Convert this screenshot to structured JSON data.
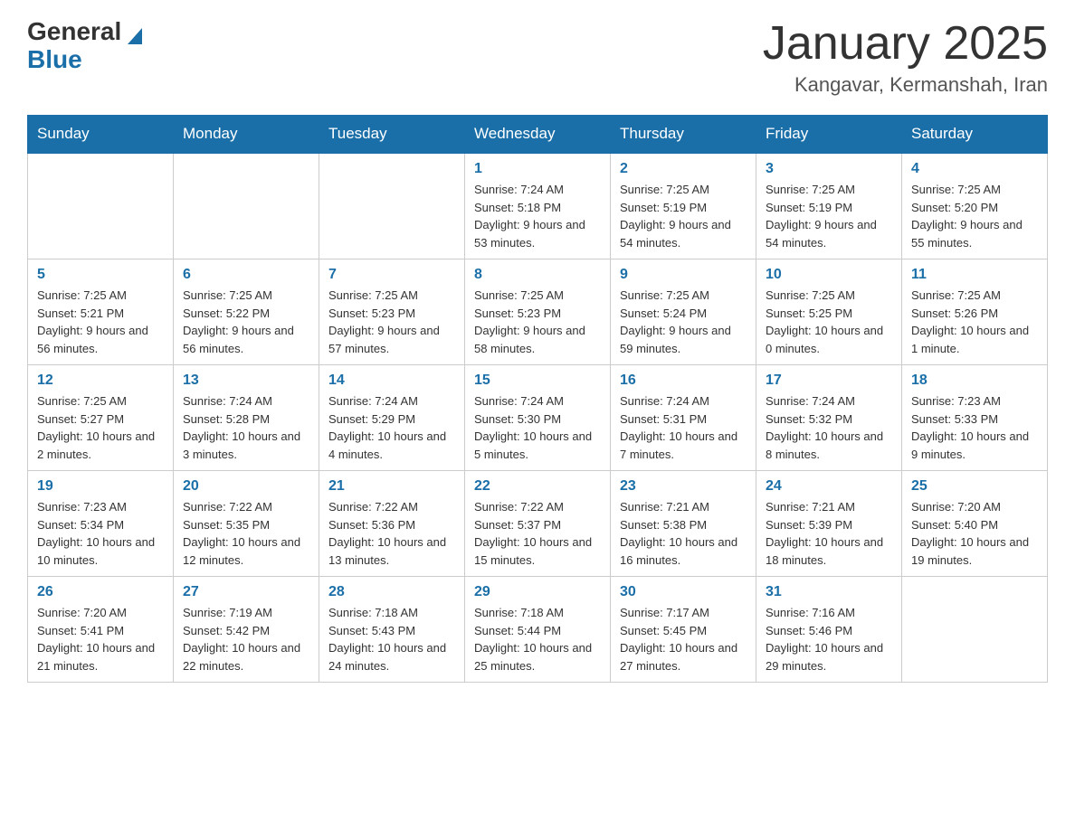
{
  "header": {
    "logo_general": "General",
    "logo_blue": "Blue",
    "month_title": "January 2025",
    "location": "Kangavar, Kermanshah, Iran"
  },
  "days_of_week": [
    "Sunday",
    "Monday",
    "Tuesday",
    "Wednesday",
    "Thursday",
    "Friday",
    "Saturday"
  ],
  "weeks": [
    [
      {
        "day": "",
        "sunrise": "",
        "sunset": "",
        "daylight": ""
      },
      {
        "day": "",
        "sunrise": "",
        "sunset": "",
        "daylight": ""
      },
      {
        "day": "",
        "sunrise": "",
        "sunset": "",
        "daylight": ""
      },
      {
        "day": "1",
        "sunrise": "Sunrise: 7:24 AM",
        "sunset": "Sunset: 5:18 PM",
        "daylight": "Daylight: 9 hours and 53 minutes."
      },
      {
        "day": "2",
        "sunrise": "Sunrise: 7:25 AM",
        "sunset": "Sunset: 5:19 PM",
        "daylight": "Daylight: 9 hours and 54 minutes."
      },
      {
        "day": "3",
        "sunrise": "Sunrise: 7:25 AM",
        "sunset": "Sunset: 5:19 PM",
        "daylight": "Daylight: 9 hours and 54 minutes."
      },
      {
        "day": "4",
        "sunrise": "Sunrise: 7:25 AM",
        "sunset": "Sunset: 5:20 PM",
        "daylight": "Daylight: 9 hours and 55 minutes."
      }
    ],
    [
      {
        "day": "5",
        "sunrise": "Sunrise: 7:25 AM",
        "sunset": "Sunset: 5:21 PM",
        "daylight": "Daylight: 9 hours and 56 minutes."
      },
      {
        "day": "6",
        "sunrise": "Sunrise: 7:25 AM",
        "sunset": "Sunset: 5:22 PM",
        "daylight": "Daylight: 9 hours and 56 minutes."
      },
      {
        "day": "7",
        "sunrise": "Sunrise: 7:25 AM",
        "sunset": "Sunset: 5:23 PM",
        "daylight": "Daylight: 9 hours and 57 minutes."
      },
      {
        "day": "8",
        "sunrise": "Sunrise: 7:25 AM",
        "sunset": "Sunset: 5:23 PM",
        "daylight": "Daylight: 9 hours and 58 minutes."
      },
      {
        "day": "9",
        "sunrise": "Sunrise: 7:25 AM",
        "sunset": "Sunset: 5:24 PM",
        "daylight": "Daylight: 9 hours and 59 minutes."
      },
      {
        "day": "10",
        "sunrise": "Sunrise: 7:25 AM",
        "sunset": "Sunset: 5:25 PM",
        "daylight": "Daylight: 10 hours and 0 minutes."
      },
      {
        "day": "11",
        "sunrise": "Sunrise: 7:25 AM",
        "sunset": "Sunset: 5:26 PM",
        "daylight": "Daylight: 10 hours and 1 minute."
      }
    ],
    [
      {
        "day": "12",
        "sunrise": "Sunrise: 7:25 AM",
        "sunset": "Sunset: 5:27 PM",
        "daylight": "Daylight: 10 hours and 2 minutes."
      },
      {
        "day": "13",
        "sunrise": "Sunrise: 7:24 AM",
        "sunset": "Sunset: 5:28 PM",
        "daylight": "Daylight: 10 hours and 3 minutes."
      },
      {
        "day": "14",
        "sunrise": "Sunrise: 7:24 AM",
        "sunset": "Sunset: 5:29 PM",
        "daylight": "Daylight: 10 hours and 4 minutes."
      },
      {
        "day": "15",
        "sunrise": "Sunrise: 7:24 AM",
        "sunset": "Sunset: 5:30 PM",
        "daylight": "Daylight: 10 hours and 5 minutes."
      },
      {
        "day": "16",
        "sunrise": "Sunrise: 7:24 AM",
        "sunset": "Sunset: 5:31 PM",
        "daylight": "Daylight: 10 hours and 7 minutes."
      },
      {
        "day": "17",
        "sunrise": "Sunrise: 7:24 AM",
        "sunset": "Sunset: 5:32 PM",
        "daylight": "Daylight: 10 hours and 8 minutes."
      },
      {
        "day": "18",
        "sunrise": "Sunrise: 7:23 AM",
        "sunset": "Sunset: 5:33 PM",
        "daylight": "Daylight: 10 hours and 9 minutes."
      }
    ],
    [
      {
        "day": "19",
        "sunrise": "Sunrise: 7:23 AM",
        "sunset": "Sunset: 5:34 PM",
        "daylight": "Daylight: 10 hours and 10 minutes."
      },
      {
        "day": "20",
        "sunrise": "Sunrise: 7:22 AM",
        "sunset": "Sunset: 5:35 PM",
        "daylight": "Daylight: 10 hours and 12 minutes."
      },
      {
        "day": "21",
        "sunrise": "Sunrise: 7:22 AM",
        "sunset": "Sunset: 5:36 PM",
        "daylight": "Daylight: 10 hours and 13 minutes."
      },
      {
        "day": "22",
        "sunrise": "Sunrise: 7:22 AM",
        "sunset": "Sunset: 5:37 PM",
        "daylight": "Daylight: 10 hours and 15 minutes."
      },
      {
        "day": "23",
        "sunrise": "Sunrise: 7:21 AM",
        "sunset": "Sunset: 5:38 PM",
        "daylight": "Daylight: 10 hours and 16 minutes."
      },
      {
        "day": "24",
        "sunrise": "Sunrise: 7:21 AM",
        "sunset": "Sunset: 5:39 PM",
        "daylight": "Daylight: 10 hours and 18 minutes."
      },
      {
        "day": "25",
        "sunrise": "Sunrise: 7:20 AM",
        "sunset": "Sunset: 5:40 PM",
        "daylight": "Daylight: 10 hours and 19 minutes."
      }
    ],
    [
      {
        "day": "26",
        "sunrise": "Sunrise: 7:20 AM",
        "sunset": "Sunset: 5:41 PM",
        "daylight": "Daylight: 10 hours and 21 minutes."
      },
      {
        "day": "27",
        "sunrise": "Sunrise: 7:19 AM",
        "sunset": "Sunset: 5:42 PM",
        "daylight": "Daylight: 10 hours and 22 minutes."
      },
      {
        "day": "28",
        "sunrise": "Sunrise: 7:18 AM",
        "sunset": "Sunset: 5:43 PM",
        "daylight": "Daylight: 10 hours and 24 minutes."
      },
      {
        "day": "29",
        "sunrise": "Sunrise: 7:18 AM",
        "sunset": "Sunset: 5:44 PM",
        "daylight": "Daylight: 10 hours and 25 minutes."
      },
      {
        "day": "30",
        "sunrise": "Sunrise: 7:17 AM",
        "sunset": "Sunset: 5:45 PM",
        "daylight": "Daylight: 10 hours and 27 minutes."
      },
      {
        "day": "31",
        "sunrise": "Sunrise: 7:16 AM",
        "sunset": "Sunset: 5:46 PM",
        "daylight": "Daylight: 10 hours and 29 minutes."
      },
      {
        "day": "",
        "sunrise": "",
        "sunset": "",
        "daylight": ""
      }
    ]
  ]
}
